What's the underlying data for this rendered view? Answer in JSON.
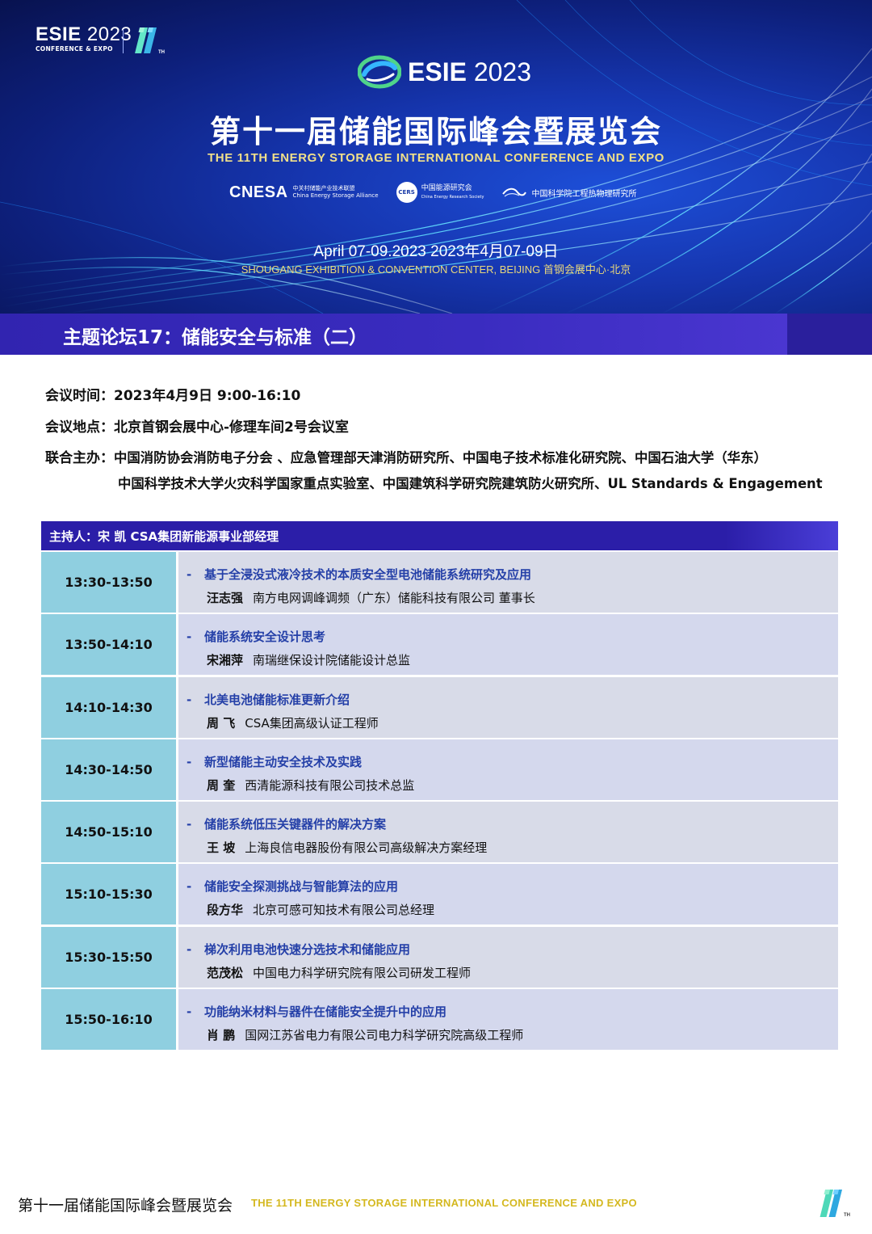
{
  "header": {
    "brand_small": "ESIE",
    "brand_small_year": "2023",
    "brand_small_sub": "CONFERENCE & EXPO",
    "edition_mark": "11",
    "edition_suffix": "TH",
    "brand_center": "ESIE",
    "brand_center_year": "2023",
    "title_cn": "第十一届储能国际峰会暨展览会",
    "title_en": "THE 11TH ENERGY STORAGE INTERNATIONAL CONFERENCE AND EXPO",
    "partners": {
      "cnesa": "CNESA",
      "cnesa_cn": "中关村储能产业技术联盟",
      "cnesa_en": "China Energy Storage Alliance",
      "cers_badge": "CERS",
      "cers_cn": "中国能源研究会",
      "cers_en": "China Energy Research Society",
      "third": "中国科学院工程热物理研究所"
    },
    "date": "April 07-09.2023   2023年4月07-09日",
    "venue": "SHOUGANG EXHIBITION & CONVENTION CENTER, BEIJING  首钢会展中心·北京"
  },
  "forum": {
    "title": "主题论坛17：储能安全与标准（二）"
  },
  "info": {
    "time_label": "会议时间：",
    "time_value": "2023年4月9日 9:00-16:10",
    "place_label": "会议地点：",
    "place_value": "北京首钢会展中心-修理车间2号会议室",
    "host_label": "联合主办：",
    "host_line1": "中国消防协会消防电子分会 、应急管理部天津消防研究所、中国电子技术标准化研究院、中国石油大学（华东）",
    "host_line2": "中国科学技术大学火灾科学国家重点实验室、中国建筑科学研究院建筑防火研究所、UL Standards & Engagement"
  },
  "moderator": {
    "label": "主持人：宋 凯 CSA集团新能源事业部经理"
  },
  "sessions": [
    {
      "time": "13:30-13:50",
      "dash": "-",
      "topic": "基于全浸没式液冷技术的本质安全型电池储能系统研究及应用",
      "speaker": "汪志强",
      "affiliation": "南方电网调峰调频（广东）储能科技有限公司 董事长"
    },
    {
      "time": "13:50-14:10",
      "dash": "-",
      "topic": "储能系统安全设计思考",
      "speaker": "宋湘萍",
      "affiliation": "南瑞继保设计院储能设计总监"
    },
    {
      "time": "14:10-14:30",
      "dash": "-",
      "topic": "北美电池储能标准更新介绍",
      "speaker": "周  飞",
      "affiliation": "CSA集团高级认证工程师"
    },
    {
      "time": "14:30-14:50",
      "dash": "-",
      "topic": "新型储能主动安全技术及实践",
      "speaker": "周  奎",
      "affiliation": "西清能源科技有限公司技术总监"
    },
    {
      "time": "14:50-15:10",
      "dash": "-",
      "topic": "储能系统低压关键器件的解决方案",
      "speaker": "王  坡",
      "affiliation": "上海良信电器股份有限公司高级解决方案经理"
    },
    {
      "time": "15:10-15:30",
      "dash": "-",
      "topic": "储能安全探测挑战与智能算法的应用",
      "speaker": "段方华",
      "affiliation": "北京可感可知技术有限公司总经理"
    },
    {
      "time": "15:30-15:50",
      "dash": "-",
      "topic": "梯次利用电池快速分选技术和储能应用",
      "speaker": "范茂松",
      "affiliation": "中国电力科学研究院有限公司研发工程师"
    },
    {
      "time": "15:50-16:10",
      "dash": "-",
      "topic": "功能纳米材料与器件在储能安全提升中的应用",
      "speaker": "肖  鹏",
      "affiliation": "国网江苏省电力有限公司电力科学研究院高级工程师"
    }
  ],
  "footer": {
    "cn": "第十一届储能国际峰会暨展览会",
    "en": "THE 11TH ENERGY STORAGE INTERNATIONAL CONFERENCE AND EXPO",
    "edition_mark": "11",
    "edition_suffix": "TH"
  }
}
